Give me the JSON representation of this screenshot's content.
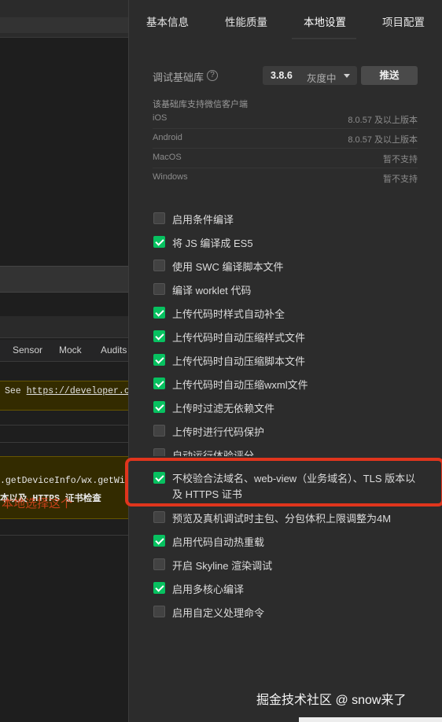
{
  "left_panel": {
    "tabs": [
      "Sensor",
      "Mock",
      "Audits"
    ],
    "warning_1": {
      "prefix": "See ",
      "link": "https://developer.c"
    },
    "warning_2": {
      "line1": ".getDeviceInfo/wx.getWind",
      "line2": "本以及 HTTPS 证书检查",
      "overlay": "本地选择这个"
    }
  },
  "tabs": [
    "基本信息",
    "性能质量",
    "本地设置",
    "项目配置"
  ],
  "active_tab": "本地设置",
  "debug_lib": {
    "label": "调试基础库",
    "help_icon": "?",
    "version": "3.8.6",
    "status": "灰度中",
    "push_label": "推送"
  },
  "support": {
    "title": "该基础库支持微信客户端",
    "rows": [
      {
        "name": "iOS",
        "value": "8.0.57 及以上版本"
      },
      {
        "name": "Android",
        "value": "8.0.57 及以上版本"
      },
      {
        "name": "MacOS",
        "value": "暂不支持"
      },
      {
        "name": "Windows",
        "value": "暂不支持"
      }
    ]
  },
  "options": [
    {
      "label": "启用条件编译",
      "checked": false
    },
    {
      "label": "将 JS 编译成 ES5",
      "checked": true
    },
    {
      "label": "使用 SWC 编译脚本文件",
      "checked": false
    },
    {
      "label": "编译 worklet 代码",
      "checked": false
    },
    {
      "label": "上传代码时样式自动补全",
      "checked": true
    },
    {
      "label": "上传代码时自动压缩样式文件",
      "checked": true
    },
    {
      "label": "上传代码时自动压缩脚本文件",
      "checked": true
    },
    {
      "label": "上传代码时自动压缩wxml文件",
      "checked": true
    },
    {
      "label": "上传时过滤无依赖文件",
      "checked": true
    },
    {
      "label": "上传时进行代码保护",
      "checked": false
    },
    {
      "label": "自动运行体验评分",
      "checked": false
    },
    {
      "label": "不校验合法域名、web-view（业务域名）、TLS 版本以及 HTTPS 证书",
      "checked": true
    },
    {
      "label": "预览及真机调试时主包、分包体积上限调整为4M",
      "checked": false
    },
    {
      "label": "启用代码自动热重载",
      "checked": true
    },
    {
      "label": "开启 Skyline 渲染调试",
      "checked": false
    },
    {
      "label": "启用多核心编译",
      "checked": true
    },
    {
      "label": "启用自定义处理命令",
      "checked": false
    }
  ],
  "watermark": "掘金技术社区 @ snow来了",
  "colors": {
    "accent_green": "#07c160",
    "highlight_red": "#e0351d",
    "panel_bg": "#2c2c2c"
  }
}
